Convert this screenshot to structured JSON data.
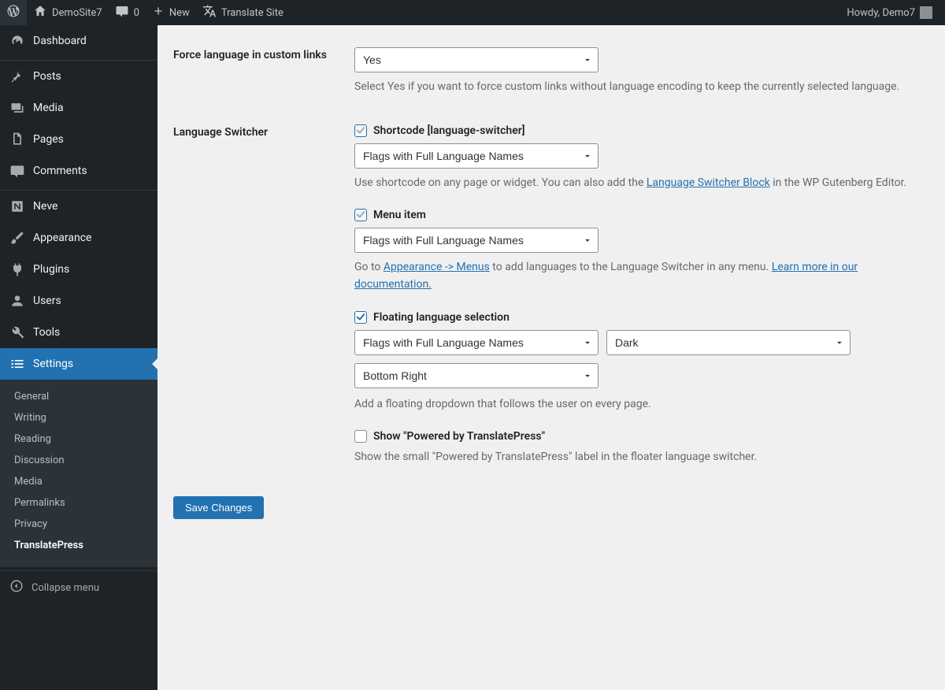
{
  "adminbar": {
    "site_name": "DemoSite7",
    "comments_count": "0",
    "new_label": "New",
    "translate_label": "Translate Site",
    "howdy": "Howdy, Demo7"
  },
  "menu": {
    "dashboard": "Dashboard",
    "posts": "Posts",
    "media": "Media",
    "pages": "Pages",
    "comments": "Comments",
    "neve": "Neve",
    "appearance": "Appearance",
    "plugins": "Plugins",
    "users": "Users",
    "tools": "Tools",
    "settings": "Settings",
    "collapse": "Collapse menu"
  },
  "settings_submenu": {
    "general": "General",
    "writing": "Writing",
    "reading": "Reading",
    "discussion": "Discussion",
    "media": "Media",
    "permalinks": "Permalinks",
    "privacy": "Privacy",
    "translatepress": "TranslatePress"
  },
  "fields": {
    "force_lang": {
      "label": "Force language in custom links",
      "value": "Yes",
      "desc": "Select Yes if you want to force custom links without language encoding to keep the currently selected language."
    },
    "language_switcher": {
      "label": "Language Switcher",
      "shortcode": {
        "label": "Shortcode [language-switcher]",
        "value": "Flags with Full Language Names",
        "desc_a": "Use shortcode on any page or widget. You can also add the ",
        "link": "Language Switcher Block",
        "desc_b": " in the WP Gutenberg Editor."
      },
      "menu": {
        "label": "Menu item",
        "value": "Flags with Full Language Names",
        "desc_a": "Go to ",
        "link_a": "Appearance -> Menus",
        "desc_b": " to add languages to the Language Switcher in any menu. ",
        "link_b": "Learn more in our documentation."
      },
      "floating": {
        "label": "Floating language selection",
        "style": "Flags with Full Language Names",
        "theme": "Dark",
        "position": "Bottom Right",
        "desc": "Add a floating dropdown that follows the user on every page."
      },
      "powered": {
        "label": "Show \"Powered by TranslatePress\"",
        "desc": "Show the small \"Powered by TranslatePress\" label in the floater language switcher."
      }
    }
  },
  "save_button": "Save Changes"
}
